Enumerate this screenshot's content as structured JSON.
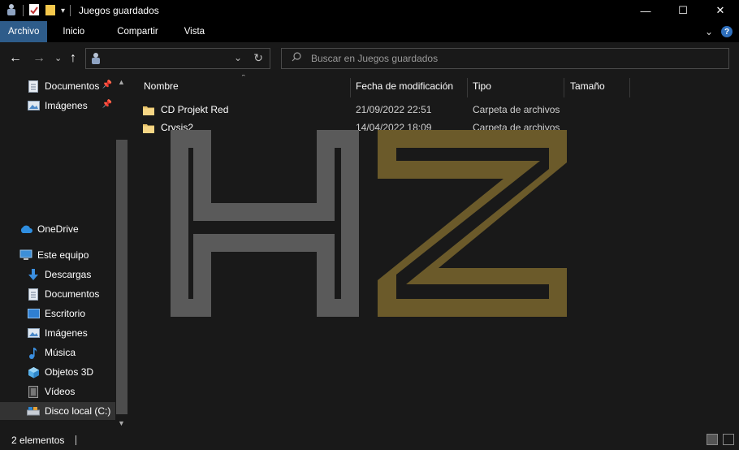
{
  "window": {
    "title": "Juegos guardados",
    "controls": {
      "minimize": "—",
      "maximize": "☐",
      "close": "✕"
    }
  },
  "ribbon": {
    "tabs": [
      "Archivo",
      "Inicio",
      "Compartir",
      "Vista"
    ],
    "active_tab": "Archivo",
    "expand_glyph": "⌄",
    "help_glyph": "?"
  },
  "address": {
    "back": "←",
    "forward": "→",
    "recent": "⌄",
    "up": "↑",
    "refresh": "↻",
    "dropdown": "⌄"
  },
  "search": {
    "placeholder": "Buscar en Juegos guardados"
  },
  "nav": {
    "quick_access": [
      {
        "label": "Documentos",
        "icon": "document-icon",
        "pinned": true
      },
      {
        "label": "Imágenes",
        "icon": "pictures-icon",
        "pinned": true
      }
    ],
    "onedrive": {
      "label": "OneDrive",
      "icon": "cloud-icon"
    },
    "this_pc": {
      "label": "Este equipo",
      "icon": "computer-icon"
    },
    "pc_items": [
      {
        "label": "Descargas",
        "icon": "download-icon"
      },
      {
        "label": "Documentos",
        "icon": "document-icon"
      },
      {
        "label": "Escritorio",
        "icon": "desktop-icon"
      },
      {
        "label": "Imágenes",
        "icon": "pictures-icon"
      },
      {
        "label": "Música",
        "icon": "music-icon"
      },
      {
        "label": "Objetos 3D",
        "icon": "cube-icon"
      },
      {
        "label": "Vídeos",
        "icon": "video-icon"
      },
      {
        "label": "Disco local (C:)",
        "icon": "drive-icon",
        "selected": true
      }
    ]
  },
  "columns": {
    "name": "Nombre",
    "date": "Fecha de modificación",
    "type": "Tipo",
    "size": "Tamaño"
  },
  "files": [
    {
      "name": "CD Projekt Red",
      "date": "21/09/2022 22:51",
      "type": "Carpeta de archivos",
      "size": ""
    },
    {
      "name": "Crysis2",
      "date": "14/04/2022 18:09",
      "type": "Carpeta de archivos",
      "size": ""
    }
  ],
  "status": {
    "count": "2 elementos"
  },
  "colors": {
    "accent": "#2e5c8a",
    "folder": "#e8c46a",
    "watermark_gray": "#5a5a5a",
    "watermark_gold": "#6b5a2a"
  }
}
